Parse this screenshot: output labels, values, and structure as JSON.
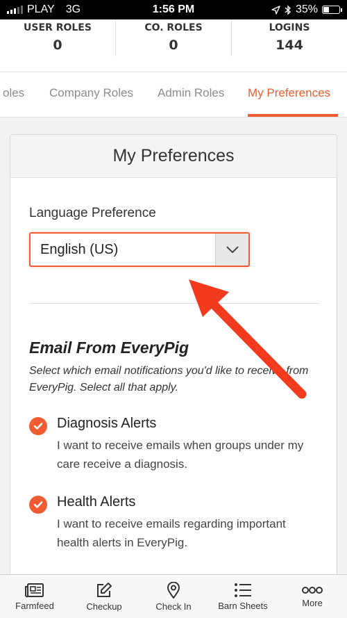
{
  "status_bar": {
    "carrier": "PLAY",
    "network": "3G",
    "time": "1:56 PM",
    "battery": "35%",
    "battery_level": 0.35
  },
  "stats": [
    {
      "label": "USER ROLES",
      "value": "0"
    },
    {
      "label": "CO. ROLES",
      "value": "0"
    },
    {
      "label": "LOGINS",
      "value": "144"
    }
  ],
  "tabs": [
    {
      "label": "oles"
    },
    {
      "label": "Company Roles"
    },
    {
      "label": "Admin Roles"
    },
    {
      "label": "My Preferences",
      "active": true
    }
  ],
  "card": {
    "title": "My Preferences",
    "language_label": "Language Preference",
    "language_value": "English (US)",
    "email_title": "Email From EveryPig",
    "email_desc": "Select which email notifications you'd like to receive from EveryPig. Select all that apply.",
    "preferences": [
      {
        "title": "Diagnosis Alerts",
        "desc": "I want to receive emails when groups under my care receive a diagnosis.",
        "checked": true
      },
      {
        "title": "Health Alerts",
        "desc": "I want to receive emails regarding important health alerts in EveryPig.",
        "checked": true
      }
    ]
  },
  "bottom_nav": [
    {
      "label": "Farmfeed",
      "icon": "newspaper-icon"
    },
    {
      "label": "Checkup",
      "icon": "edit-icon"
    },
    {
      "label": "Check In",
      "icon": "map-pin-icon"
    },
    {
      "label": "Barn Sheets",
      "icon": "list-icon"
    },
    {
      "label": "More",
      "icon": "more-icon"
    }
  ],
  "colors": {
    "accent": "#f05b31",
    "annotation": "#f23a1f"
  }
}
